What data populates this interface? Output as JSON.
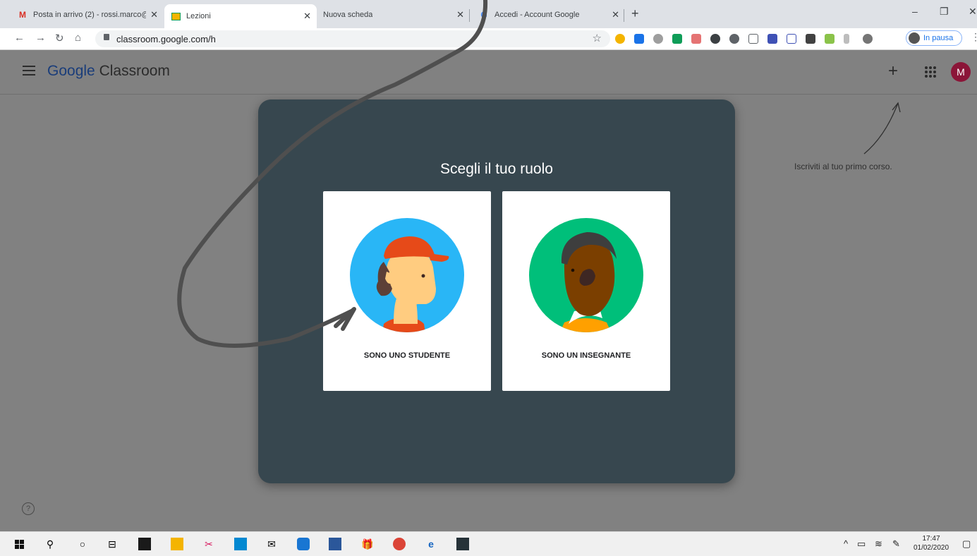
{
  "browser": {
    "tabs": [
      {
        "title": "Posta in arrivo (2) - rossi.marco@",
        "icon": "gmail-icon",
        "active": false
      },
      {
        "title": "Lezioni",
        "icon": "classroom-icon",
        "active": true
      },
      {
        "title": "Nuova scheda",
        "icon": "",
        "active": false
      },
      {
        "title": "Accedi - Account Google",
        "icon": "google-icon",
        "active": false
      }
    ],
    "url": "classroom.google.com/h",
    "profile_label": "In pausa"
  },
  "app": {
    "brand_google": "Google",
    "brand_product": "Classroom",
    "avatar_initial": "M",
    "hint": "Iscriviti al tuo primo corso.",
    "help": "?"
  },
  "dialog": {
    "title": "Scegli il tuo ruolo",
    "student_label": "SONO UNO STUDENTE",
    "teacher_label": "SONO UN INSEGNANTE"
  },
  "taskbar": {
    "time": "17:47",
    "date": "01/02/2020"
  },
  "colors": {
    "dialog_bg": "#37474f",
    "student_circle": "#29b6f6",
    "teacher_circle": "#00bf7a",
    "avatar_bg": "#8b1538"
  }
}
